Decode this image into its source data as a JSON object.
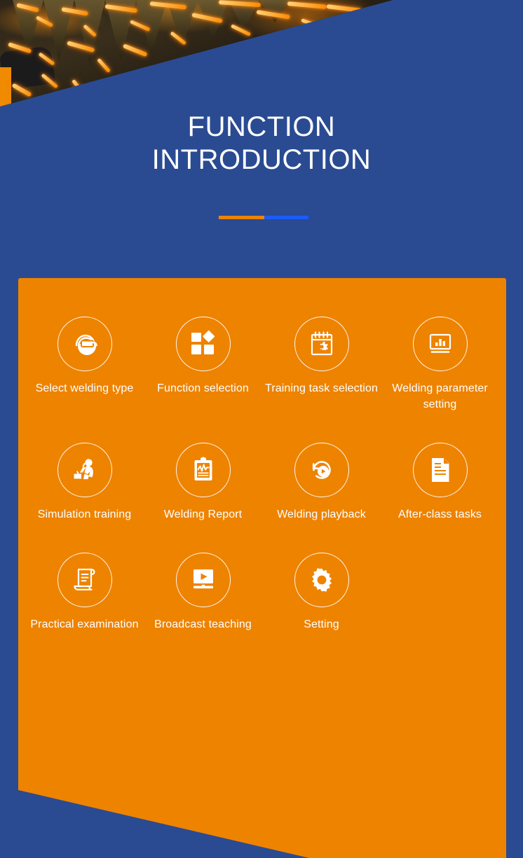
{
  "meta": {
    "page_title": "FUNCTION INTRODUCTION"
  },
  "colors": {
    "blue_background": "#2a4b92",
    "orange_panel": "#ee8300",
    "rule_orange": "#ee8300",
    "rule_blue": "#1a5cff",
    "text_white": "#ffffff"
  },
  "banner": {
    "alt": "welding-sparks-photo"
  },
  "header": {
    "title_line_1": "FUNCTION",
    "title_line_2": "INTRODUCTION"
  },
  "features": {
    "rows": [
      [
        {
          "label": "Select welding type",
          "icon": "welding-helmet-icon"
        },
        {
          "label": "Function selection",
          "icon": "grid-blocks-icon"
        },
        {
          "label": "Training task selection",
          "icon": "calendar-gear-icon"
        },
        {
          "label": "Welding parameter setting",
          "icon": "monitor-bar-chart-icon"
        }
      ],
      [
        {
          "label": "Simulation training",
          "icon": "welder-figure-icon"
        },
        {
          "label": "Welding Report",
          "icon": "clipboard-chart-icon"
        },
        {
          "label": "Welding playback",
          "icon": "replay-play-icon"
        },
        {
          "label": "After-class tasks",
          "icon": "document-page-icon"
        }
      ],
      [
        {
          "label": "Practical examination",
          "icon": "scroll-certificate-icon"
        },
        {
          "label": "Broadcast teaching",
          "icon": "monitor-play-icon"
        },
        {
          "label": "Setting",
          "icon": "gear-icon"
        },
        {
          "label": "",
          "icon": ""
        }
      ]
    ]
  }
}
